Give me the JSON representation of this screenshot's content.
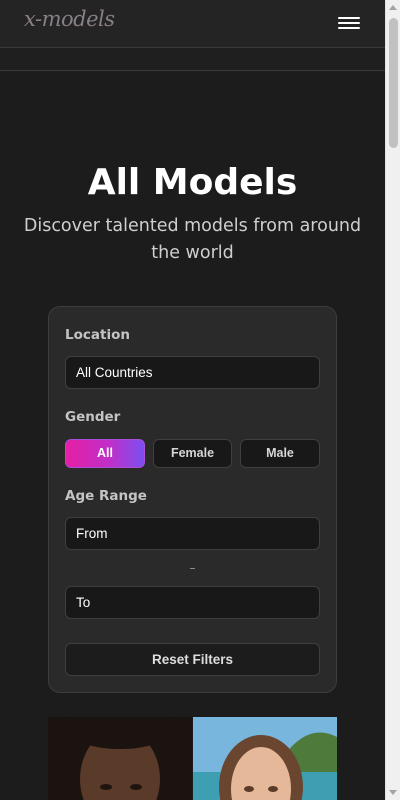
{
  "header": {
    "logo_text": "x-models",
    "menu_icon": "hamburger-menu-icon"
  },
  "hero": {
    "title": "All Models",
    "subtitle": "Discover talented models from around the world"
  },
  "filters": {
    "location_label": "Location",
    "location_value": "All Countries",
    "gender_label": "Gender",
    "gender_options": [
      "All",
      "Female",
      "Male"
    ],
    "gender_selected": "All",
    "age_label": "Age Range",
    "age_from_placeholder": "From",
    "age_separator": "–",
    "age_to_placeholder": "To",
    "reset_label": "Reset Filters"
  },
  "colors": {
    "accent_start": "#e51fa4",
    "accent_end": "#7b4ff0",
    "background": "#1c1c1c"
  }
}
